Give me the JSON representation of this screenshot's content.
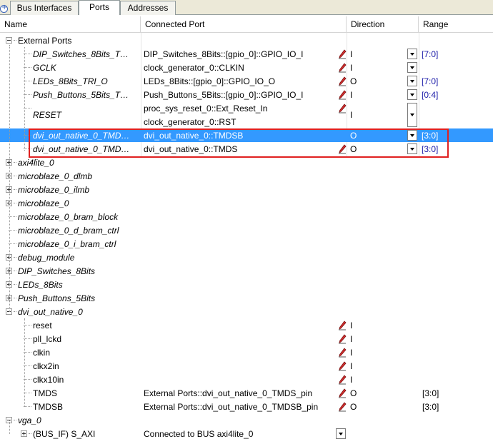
{
  "tabs": [
    {
      "label": "Bus Interfaces",
      "active": false
    },
    {
      "label": "Ports",
      "active": true
    },
    {
      "label": "Addresses",
      "active": false
    }
  ],
  "columns": {
    "name": "Name",
    "connected": "Connected Port",
    "direction": "Direction",
    "range": "Range"
  },
  "colors": {
    "selection": "#3399ff",
    "highlight_box": "#e02020",
    "range_text": "#1a1aa8"
  },
  "rows": [
    {
      "name": "External Ports",
      "italic": false,
      "expander": "minus"
    },
    {
      "name": "DIP_Switches_8Bits_T…",
      "italic": true,
      "conn": "DIP_Switches_8Bits::[gpio_0]::GPIO_IO_I",
      "pencil": true,
      "dir": "I",
      "dd": true,
      "range": "[7:0]"
    },
    {
      "name": "GCLK",
      "italic": true,
      "conn": "clock_generator_0::CLKIN",
      "pencil": true,
      "dir": "I",
      "dd": true,
      "range": ""
    },
    {
      "name": "LEDs_8Bits_TRI_O",
      "italic": true,
      "conn": "LEDs_8Bits::[gpio_0]::GPIO_IO_O",
      "pencil": true,
      "dir": "O",
      "dd": true,
      "range": "[7:0]"
    },
    {
      "name": "Push_Buttons_5Bits_T…",
      "italic": true,
      "conn": "Push_Buttons_5Bits::[gpio_0]::GPIO_IO_I",
      "pencil": true,
      "dir": "I",
      "dd": true,
      "range": "[0:4]"
    },
    {
      "name": "RESET",
      "italic": true,
      "conn": "proc_sys_reset_0::Ext_Reset_In",
      "conn2": "clock_generator_0::RST",
      "pencil": true,
      "dir": "I",
      "dd": true,
      "range": "",
      "tall": true
    },
    {
      "name": "dvi_out_native_0_TMD…",
      "italic": true,
      "conn": "dvi_out_native_0::TMDSB",
      "pencil": false,
      "dir": "O",
      "dd": true,
      "range": "[3:0]",
      "selected": true
    },
    {
      "name": "dvi_out_native_0_TMD…",
      "italic": true,
      "conn": "dvi_out_native_0::TMDS",
      "pencil": true,
      "dir": "O",
      "dd": true,
      "range": "[3:0]"
    },
    {
      "name": "axi4lite_0",
      "italic": true,
      "expander": "plus"
    },
    {
      "name": "microblaze_0_dlmb",
      "italic": true,
      "expander": "plus"
    },
    {
      "name": "microblaze_0_ilmb",
      "italic": true,
      "expander": "plus"
    },
    {
      "name": "microblaze_0",
      "italic": true,
      "expander": "plus"
    },
    {
      "name": "microblaze_0_bram_block",
      "italic": true,
      "expander": "none"
    },
    {
      "name": "microblaze_0_d_bram_ctrl",
      "italic": true,
      "expander": "none"
    },
    {
      "name": "microblaze_0_i_bram_ctrl",
      "italic": true,
      "expander": "none"
    },
    {
      "name": "debug_module",
      "italic": true,
      "expander": "plus"
    },
    {
      "name": "DIP_Switches_8Bits",
      "italic": true,
      "expander": "plus"
    },
    {
      "name": "LEDs_8Bits",
      "italic": true,
      "expander": "plus"
    },
    {
      "name": "Push_Buttons_5Bits",
      "italic": true,
      "expander": "plus"
    },
    {
      "name": "dvi_out_native_0",
      "italic": true,
      "expander": "minus"
    },
    {
      "name": "reset",
      "italic": false,
      "conn": "",
      "pencil": true,
      "dir": "I",
      "range": ""
    },
    {
      "name": "pll_lckd",
      "italic": false,
      "conn": "",
      "pencil": true,
      "dir": "I",
      "range": ""
    },
    {
      "name": "clkin",
      "italic": false,
      "conn": "",
      "pencil": true,
      "dir": "I",
      "range": ""
    },
    {
      "name": "clkx2in",
      "italic": false,
      "conn": "",
      "pencil": true,
      "dir": "I",
      "range": ""
    },
    {
      "name": "clkx10in",
      "italic": false,
      "conn": "",
      "pencil": true,
      "dir": "I",
      "range": ""
    },
    {
      "name": "TMDS",
      "italic": false,
      "conn": "External Ports::dvi_out_native_0_TMDS_pin",
      "pencil": true,
      "dir": "O",
      "range": "[3:0]"
    },
    {
      "name": "TMDSB",
      "italic": false,
      "conn": "External Ports::dvi_out_native_0_TMDSB_pin",
      "pencil": true,
      "dir": "O",
      "range": "[3:0]"
    },
    {
      "name": "vga_0",
      "italic": true,
      "expander": "minus"
    },
    {
      "name": "(BUS_IF) S_AXI",
      "italic": false,
      "expander": "plus",
      "conn": "Connected to BUS axi4lite_0",
      "ddConn": true
    }
  ]
}
